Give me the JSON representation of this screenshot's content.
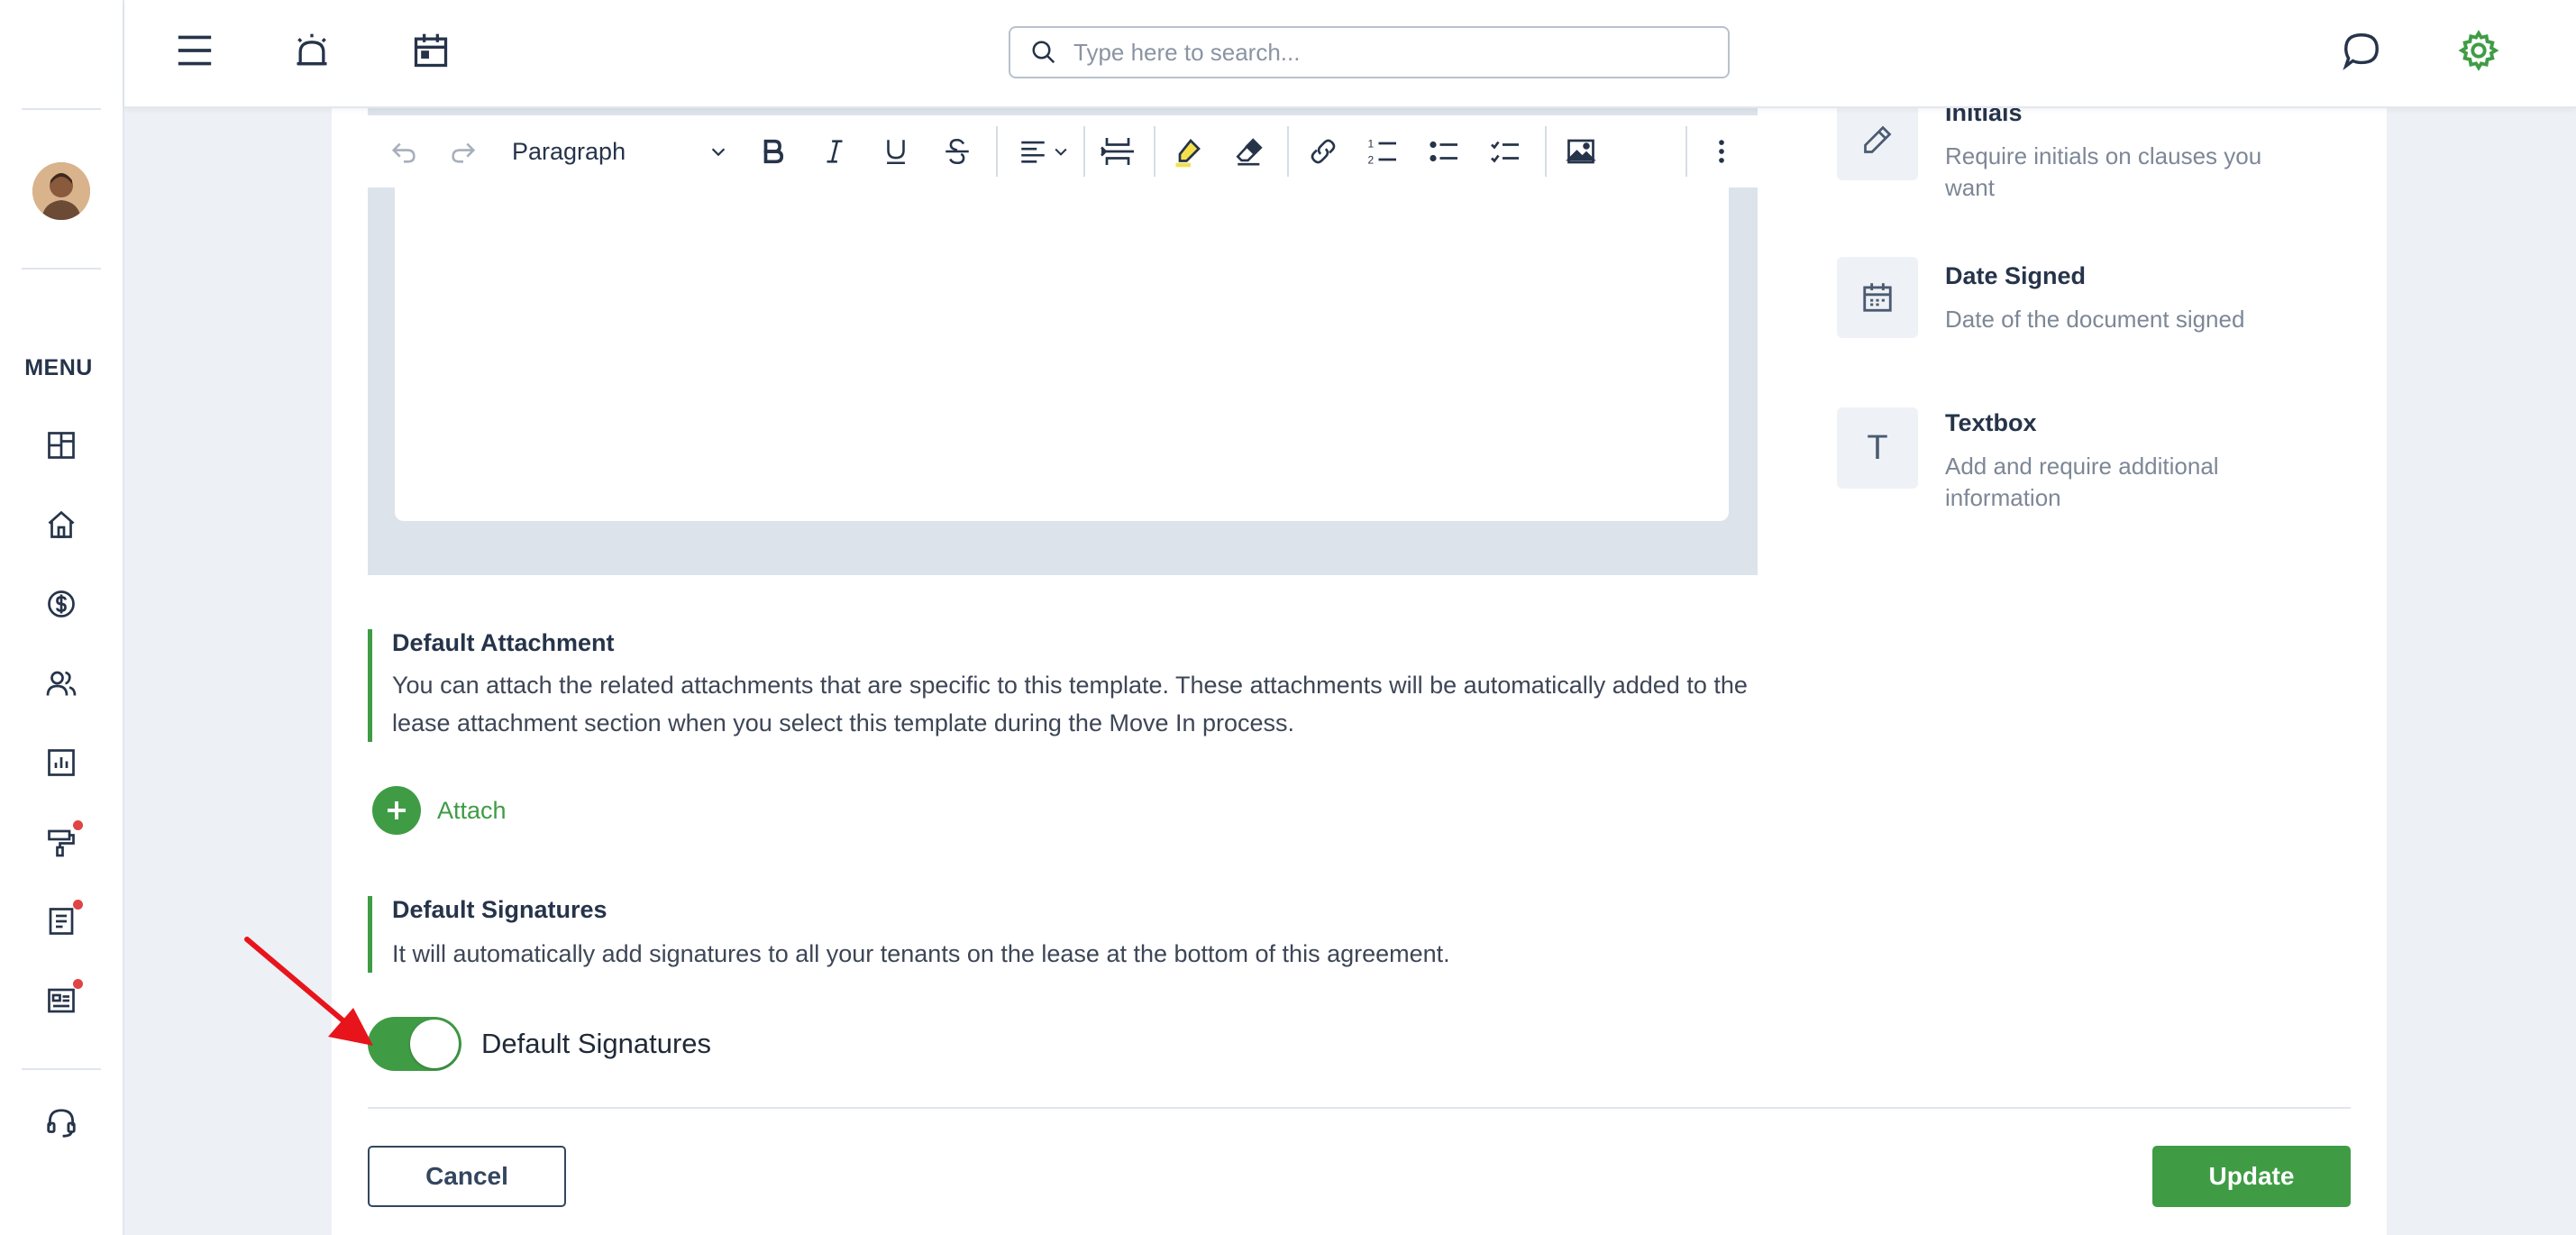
{
  "sidebar": {
    "menu_label": "MENU",
    "items": [
      {
        "icon": "dashboard-icon"
      },
      {
        "icon": "home-icon"
      },
      {
        "icon": "dollar-icon"
      },
      {
        "icon": "people-icon"
      },
      {
        "icon": "reports-icon"
      },
      {
        "icon": "maintenance-icon",
        "badge": true
      },
      {
        "icon": "document-icon",
        "badge": true
      },
      {
        "icon": "listing-icon",
        "badge": true
      }
    ],
    "support_icon": "headset-icon"
  },
  "topbar": {
    "search_placeholder": "Type here to search..."
  },
  "editor": {
    "paragraph_style": "Paragraph"
  },
  "fields": {
    "initials": {
      "title": "Initials",
      "description": "Require initials on clauses you want"
    },
    "date_signed": {
      "title": "Date Signed",
      "description": "Date of the document signed"
    },
    "textbox": {
      "title": "Textbox",
      "description": "Add and require additional information",
      "glyph": "T"
    }
  },
  "default_attachment": {
    "title": "Default Attachment",
    "description": "You can attach the related attachments that are specific to this template. These attachments will be automatically added to the lease attachment section when you select this template during the Move In process.",
    "attach_label": "Attach"
  },
  "default_signatures": {
    "title": "Default Signatures",
    "description": "It will automatically add signatures to all your tenants on the lease at the bottom of this agreement.",
    "toggle_label": "Default Signatures",
    "toggle_on": true
  },
  "actions": {
    "cancel_label": "Cancel",
    "update_label": "Update"
  },
  "colors": {
    "accent": "#3f9c45",
    "text_dark": "#26344a",
    "badge": "#e04444"
  }
}
